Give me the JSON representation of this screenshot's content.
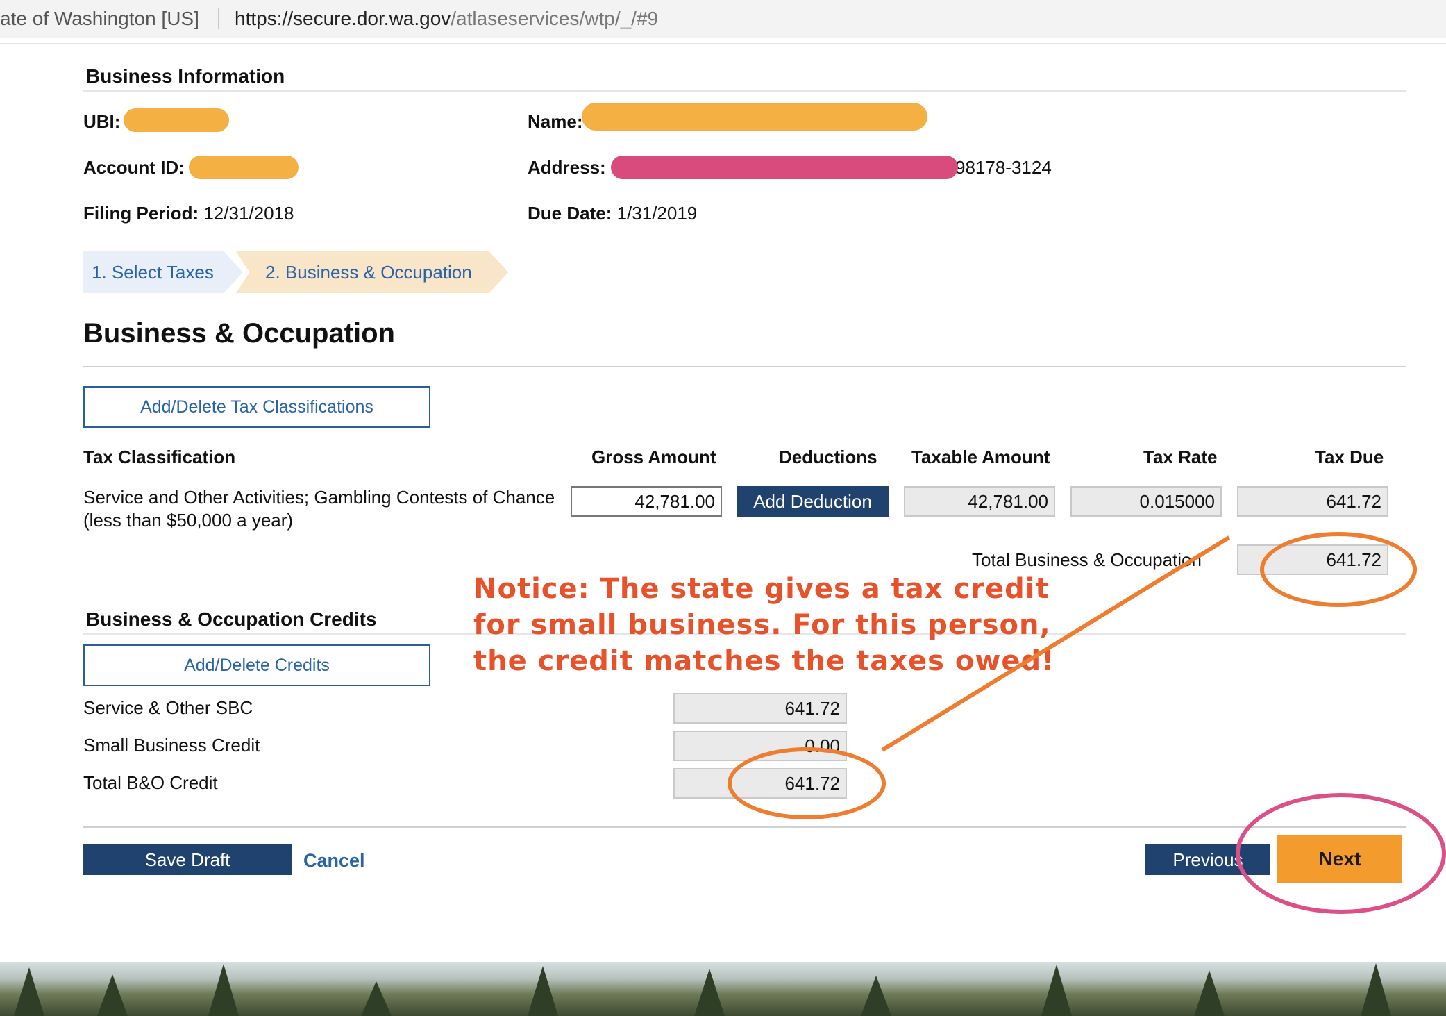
{
  "browser": {
    "site_identity": "ate of Washington [US]",
    "url_host": "https://secure.dor.wa.gov",
    "url_path": "/atlaseservices/wtp/_/#9"
  },
  "business_info": {
    "title": "Business Information",
    "ubi_label": "UBI:",
    "ubi_value": "",
    "name_label": "Name:",
    "name_value": "",
    "account_label": "Account ID:",
    "account_value": "",
    "address_label": "Address:",
    "address_value_visible": "98178-3124",
    "filing_period_label": "Filing Period:",
    "filing_period_value": "12/31/2018",
    "due_date_label": "Due Date:",
    "due_date_value": "1/31/2019"
  },
  "steps": [
    {
      "label": "1. Select Taxes",
      "state": "complete"
    },
    {
      "label": "2. Business & Occupation",
      "state": "active"
    }
  ],
  "page_title": "Business & Occupation",
  "classifications": {
    "button_label": "Add/Delete Tax Classifications",
    "headers": {
      "classification": "Tax Classification",
      "gross": "Gross Amount",
      "deductions": "Deductions",
      "taxable": "Taxable Amount",
      "rate": "Tax Rate",
      "due": "Tax Due"
    },
    "rows": [
      {
        "description": "Service and Other Activities; Gambling Contests of Chance (less than $50,000 a year)",
        "gross": "42,781.00",
        "deduction_button": "Add Deduction",
        "taxable": "42,781.00",
        "rate": "0.015000",
        "due": "641.72"
      }
    ],
    "total_label": "Total Business & Occupation",
    "total_value": "641.72"
  },
  "credits": {
    "title": "Business & Occupation Credits",
    "button_label": "Add/Delete Credits",
    "items": [
      {
        "label": "Service & Other SBC",
        "value": "641.72"
      },
      {
        "label": "Small Business Credit",
        "value": "0.00"
      },
      {
        "label": "Total B&O Credit",
        "value": "641.72"
      }
    ]
  },
  "actions": {
    "save_draft": "Save Draft",
    "cancel": "Cancel",
    "previous": "Previous",
    "next": "Next"
  },
  "annotation": {
    "text": "Notice: The state gives a tax credit for small business. For this person, the credit matches the taxes owed!",
    "color": "#e8522a"
  },
  "colors": {
    "primary_navy": "#20426f",
    "accent_orange": "#f39c2d",
    "link_blue": "#2a63a8",
    "highlight_circle_orange": "#ef7d2f",
    "highlight_circle_pink": "#dc5087"
  }
}
